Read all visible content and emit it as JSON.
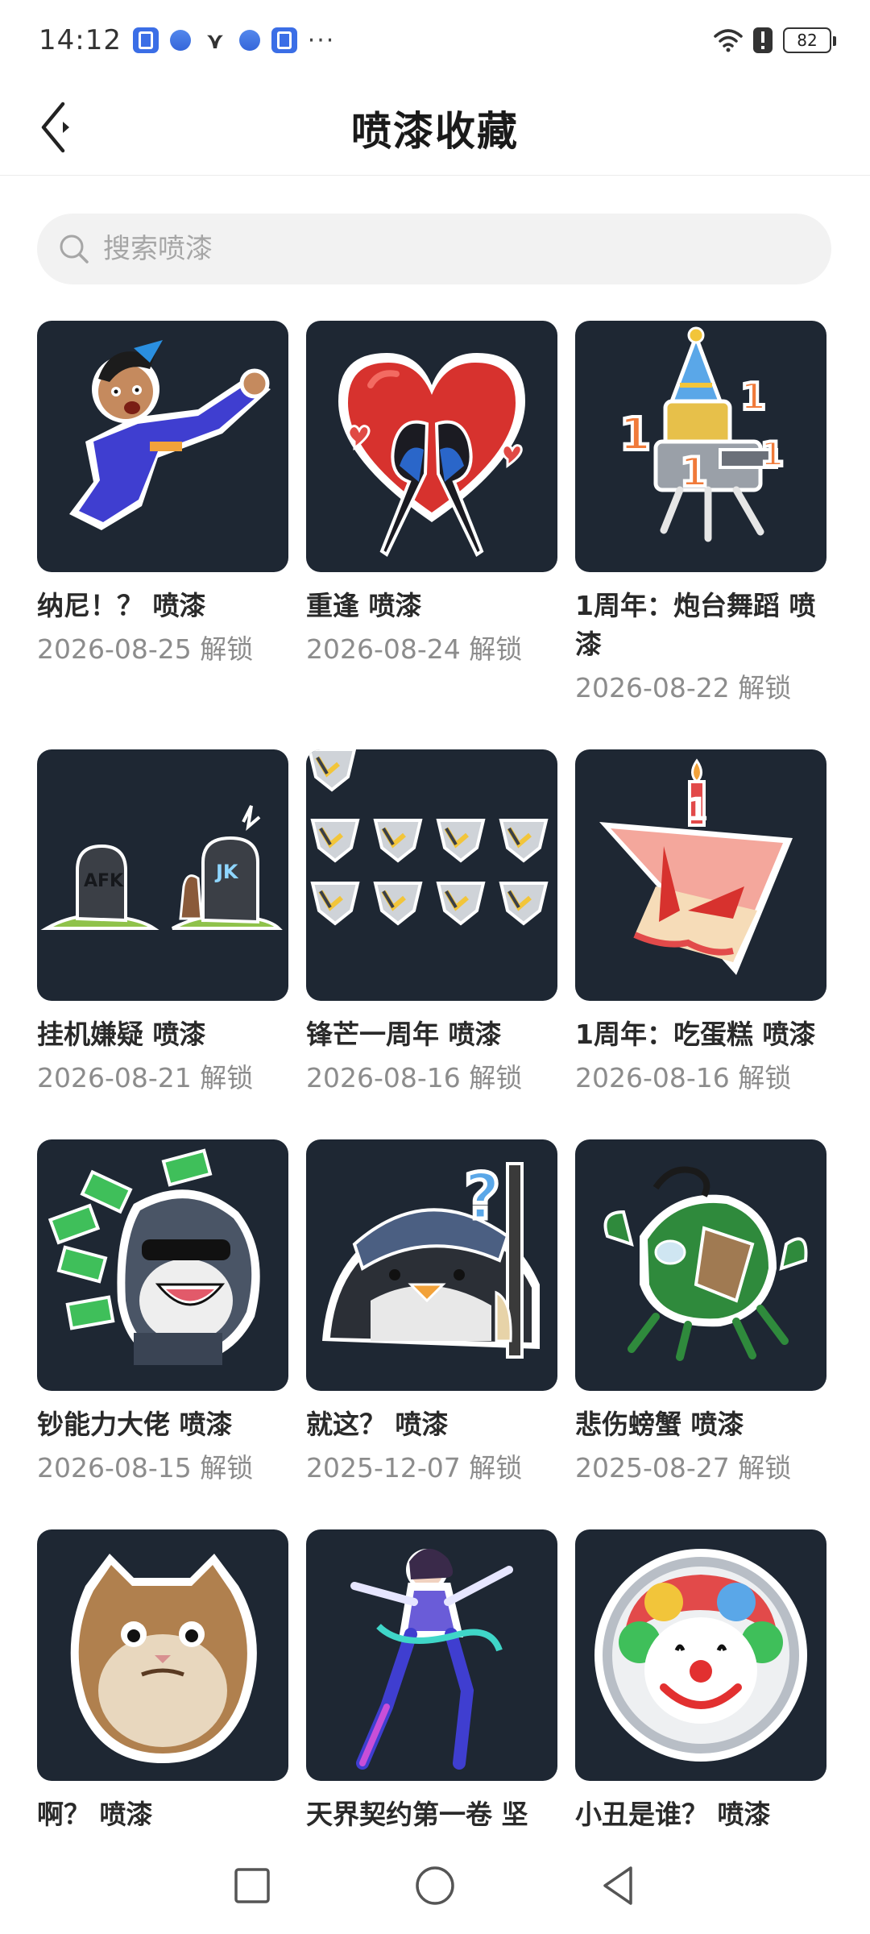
{
  "status_bar": {
    "time": "14:12",
    "battery": "82",
    "icons": [
      "app-notification-icon",
      "gem-icon",
      "vivo-icon",
      "gem-icon",
      "app-notification-icon",
      "more-dots-icon",
      "wifi-icon",
      "alert-icon",
      "battery-icon"
    ]
  },
  "header": {
    "title": "喷漆收藏",
    "back_icon": "chevron-left-icon"
  },
  "search": {
    "placeholder": "搜索喷漆",
    "value": ""
  },
  "sprays": [
    {
      "name": "纳尼！？ 喷漆",
      "date": "2026-08-25 解锁",
      "art": "shocked-agent"
    },
    {
      "name": "重逢 喷漆",
      "date": "2026-08-24 解锁",
      "art": "magpies-heart"
    },
    {
      "name": "1周年：炮台舞蹈 喷漆",
      "date": "2026-08-22 解锁",
      "art": "turret-party"
    },
    {
      "name": "挂机嫌疑 喷漆",
      "date": "2026-08-21 解锁",
      "art": "afk-graves"
    },
    {
      "name": "锋芒一周年 喷漆",
      "date": "2026-08-16 解锁",
      "art": "badges"
    },
    {
      "name": "1周年：吃蛋糕 喷漆",
      "date": "2026-08-16 解锁",
      "art": "cake"
    },
    {
      "name": "钞能力大佬 喷漆",
      "date": "2026-08-15 解锁",
      "art": "money-penguin"
    },
    {
      "name": "就这？ 喷漆",
      "date": "2025-12-07 解锁",
      "art": "question-penguin"
    },
    {
      "name": "悲伤螃蟹 喷漆",
      "date": "2025-08-27 解锁",
      "art": "sad-crab"
    },
    {
      "name": "啊？ 喷漆",
      "date": "",
      "art": "grumpy-cat"
    },
    {
      "name": "天界契约第一卷 坚",
      "date": "",
      "art": "dancer"
    },
    {
      "name": "小丑是谁？ 喷漆",
      "date": "",
      "art": "clown"
    }
  ],
  "colors": {
    "card_bg": "#1e2733",
    "date_text": "#8c8c8c",
    "search_bg": "#f2f2f2"
  },
  "nav": {
    "icons": [
      "recents-square-icon",
      "home-circle-icon",
      "back-triangle-icon"
    ]
  }
}
